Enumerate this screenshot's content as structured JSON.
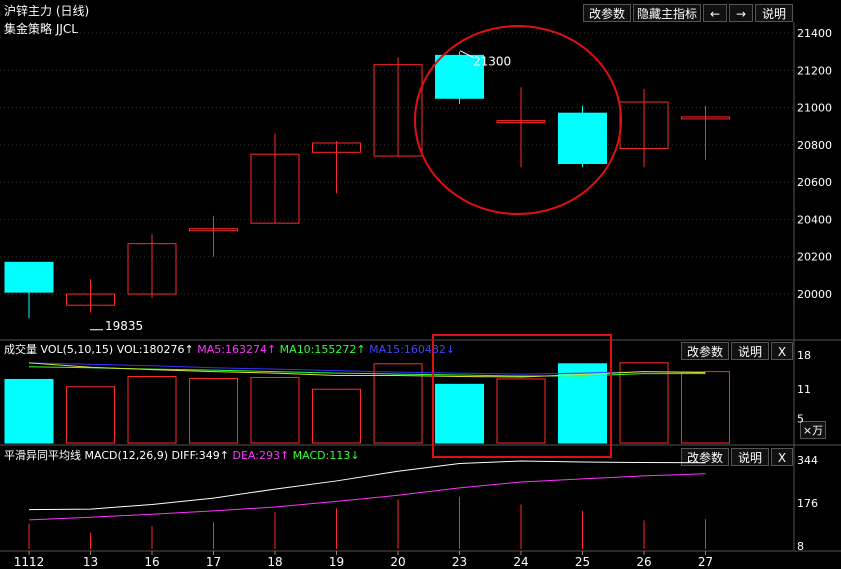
{
  "header": {
    "title": "沪锌主力 (日线)",
    "buttons": {
      "params": "改参数",
      "hide": "隐藏主指标",
      "prev": "←",
      "next": "→",
      "help": "说明"
    }
  },
  "price_panel": {
    "label": "集金策略 JJCL"
  },
  "volume_panel": {
    "title": "成交量",
    "indicator": "VOL(5,10,15)",
    "vol": "VOL:180276↑",
    "ma5": "MA5:163274↑",
    "ma10": "MA10:155272↑",
    "ma15": "MA15:160482↓",
    "unit": "×万",
    "buttons": {
      "params": "改参数",
      "help": "说明",
      "close": "X"
    }
  },
  "macd_panel": {
    "title": "平滑异同平均线",
    "indicator": "MACD(12,26,9)",
    "diff": "DIFF:349↑",
    "dea": "DEA:293↑",
    "macd": "MACD:113↓",
    "buttons": {
      "params": "改参数",
      "help": "说明",
      "close": "X"
    }
  },
  "colors": {
    "up": "#ff2a2a",
    "down": "#00ffff",
    "ma5": "#ff33ff",
    "ma10": "#33ff33",
    "ma15": "#3333ff",
    "dea": "#ff33ff",
    "diff": "#ffffff",
    "circle": "#e01010"
  },
  "chart_data": [
    {
      "type": "candlestick",
      "categories": [
        "1112",
        "13",
        "16",
        "17",
        "18",
        "19",
        "20",
        "23",
        "24",
        "25",
        "26",
        "27"
      ],
      "ohlc": [
        [
          20170,
          20170,
          19870,
          20010
        ],
        [
          19940,
          20080,
          19900,
          20000
        ],
        [
          20000,
          20320,
          19980,
          20270
        ],
        [
          20350,
          20420,
          20200,
          20350
        ],
        [
          20380,
          20860,
          20380,
          20750
        ],
        [
          20760,
          20820,
          20540,
          20810
        ],
        [
          20740,
          21270,
          20740,
          21230
        ],
        [
          21280,
          21300,
          21020,
          21050
        ],
        [
          20930,
          21110,
          20680,
          20930
        ],
        [
          20970,
          21010,
          20680,
          20700
        ],
        [
          20780,
          21100,
          20680,
          21030
        ],
        [
          20950,
          21010,
          20720,
          20950
        ]
      ],
      "annotations": [
        "19835",
        "21300"
      ],
      "y_ticks": [
        "21400",
        "21200",
        "21000",
        "20800",
        "20600",
        "20400",
        "20200",
        "20000"
      ],
      "ylim": [
        19810,
        21440
      ]
    },
    {
      "type": "bar",
      "name": "VOL",
      "values": [
        13.0,
        11.5,
        13.6,
        13.2,
        13.4,
        11.0,
        16.2,
        12.0,
        13.1,
        16.2,
        16.4,
        14.6
      ],
      "ma5": [
        16.4,
        15.5,
        15.0,
        14.6,
        14.3,
        13.8,
        13.8,
        13.6,
        13.5,
        14.0,
        14.6,
        14.4
      ],
      "ma10": [
        15.6,
        15.4,
        15.1,
        14.9,
        14.6,
        14.3,
        14.1,
        13.9,
        13.7,
        13.7,
        14.2,
        14.2
      ],
      "ma15": [
        16.4,
        16.1,
        15.8,
        15.4,
        15.1,
        14.8,
        14.5,
        14.3,
        14.1,
        14.3,
        14.6,
        14.6
      ],
      "y_ticks": [
        "18",
        "11",
        "5"
      ],
      "ylim": [
        0,
        19
      ]
    },
    {
      "type": "line",
      "name": "MACD",
      "diff": [
        150,
        152,
        170,
        195,
        230,
        262,
        300,
        330,
        340,
        336,
        334,
        333
      ],
      "dea": [
        110,
        120,
        132,
        145,
        160,
        182,
        206,
        235,
        258,
        270,
        282,
        290
      ],
      "macd": [
        95,
        60,
        85,
        100,
        140,
        155,
        190,
        200,
        170,
        145,
        108,
        113
      ],
      "y_ticks": [
        "344",
        "176",
        "8"
      ],
      "ylim": [
        0,
        362
      ]
    }
  ]
}
